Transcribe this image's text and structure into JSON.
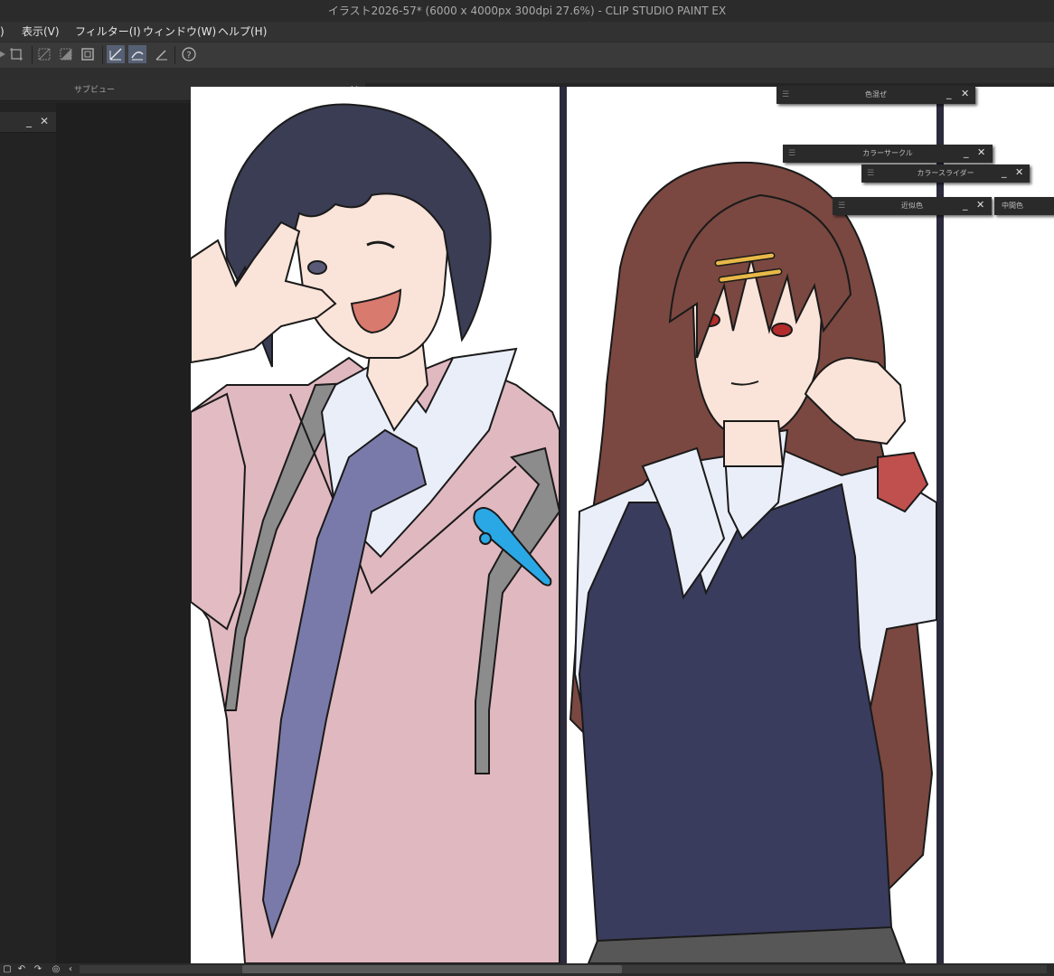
{
  "window": {
    "title": "イラスト2026-57* (6000 x 4000px 300dpi 27.6%)  - CLIP STUDIO PAINT EX"
  },
  "menu": {
    "items": [
      {
        "label": ")"
      },
      {
        "label": "表示(V)"
      },
      {
        "label": "フィルター(I)"
      },
      {
        "label": "ウィンドウ(W)"
      },
      {
        "label": "ヘルプ(H)"
      }
    ]
  },
  "toolbar": {
    "buttons": [
      {
        "icon": "play-arrow-icon"
      },
      {
        "icon": "crop-icon"
      },
      {
        "icon": "select-none-icon"
      },
      {
        "icon": "invert-selection-icon"
      },
      {
        "icon": "selection-border-icon"
      },
      {
        "icon": "ruler-snap-icon",
        "active": true
      },
      {
        "icon": "special-ruler-snap-icon",
        "active": true
      },
      {
        "icon": "grid-snap-icon"
      },
      {
        "icon": "help-icon"
      }
    ]
  },
  "panels": {
    "subview": {
      "title": "サブビュー",
      "minimize": "_",
      "close": "✕"
    },
    "left_stub": {
      "minimize": "_",
      "close": "✕"
    }
  },
  "palettes": [
    {
      "title": "色混ぜ",
      "minimize": "_",
      "close": "✕"
    },
    {
      "title": "カラーサークル",
      "minimize": "_",
      "close": "✕"
    },
    {
      "title": "カラースライダー",
      "minimize": "_",
      "close": "✕"
    },
    {
      "title": "近似色",
      "minimize": "_",
      "close": "✕"
    },
    {
      "title": "中間色"
    }
  ],
  "colors": {
    "app_dark": "#252525",
    "toolbar_active": "#566074",
    "canvas_bg": "#ffffff",
    "boy_hair": "#3a3d54",
    "cardigan": "#e0b8c0",
    "tie": "#7a7aaa",
    "strap": "#8c8c8c",
    "girl_hair": "#7a4840",
    "vest": "#3a3c5e",
    "shirt": "#eaeef9",
    "skin": "#fae3d8",
    "hair_clip": "#2aa8e6"
  },
  "bottom": {
    "buttons": [
      "undo-icon",
      "redo-icon",
      "reset-icon",
      "nav-left-icon"
    ]
  }
}
